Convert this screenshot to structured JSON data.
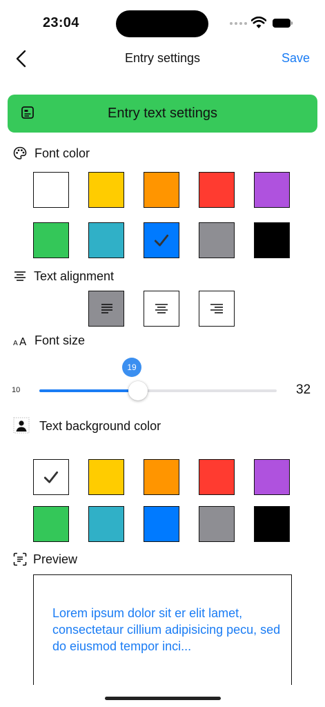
{
  "status_bar": {
    "time": "23:04"
  },
  "nav": {
    "back_icon": "chevron-left-icon",
    "title": "Entry settings",
    "save_label": "Save",
    "accent": "#1a7cf4"
  },
  "banner": {
    "icon": "text-document-icon",
    "title": "Entry text settings",
    "color": "#37c95a"
  },
  "font_color": {
    "label": "Font color",
    "icon": "palette-icon",
    "swatches": [
      "#ffffff",
      "#ffcc00",
      "#ff9500",
      "#ff3b30",
      "#af52de",
      "#34c759",
      "#30b0c7",
      "#007aff",
      "#8e8e93",
      "#000000"
    ],
    "selected": "#007aff"
  },
  "text_alignment": {
    "label": "Text alignment",
    "icon": "text-center-icon",
    "options": [
      "left",
      "center",
      "right"
    ],
    "selected": "left"
  },
  "font_size": {
    "label": "Font size",
    "icon": "textformat-size-icon",
    "min": "10",
    "max": "32",
    "value": "19"
  },
  "background_color": {
    "label": "Text background color",
    "icon": "person-on-background-icon",
    "swatches": [
      "#ffffff",
      "#ffcc00",
      "#ff9500",
      "#ff3b30",
      "#af52de",
      "#34c759",
      "#30b0c7",
      "#007aff",
      "#8e8e93",
      "#000000"
    ],
    "selected": "#ffffff"
  },
  "preview": {
    "label": "Preview",
    "icon": "text-viewfinder-icon",
    "text": "Lorem ipsum dolor sit er elit lamet, consectetaur cillium adipisicing pecu, sed do eiusmod tempor inci...",
    "text_color": "#1a7cf4"
  }
}
